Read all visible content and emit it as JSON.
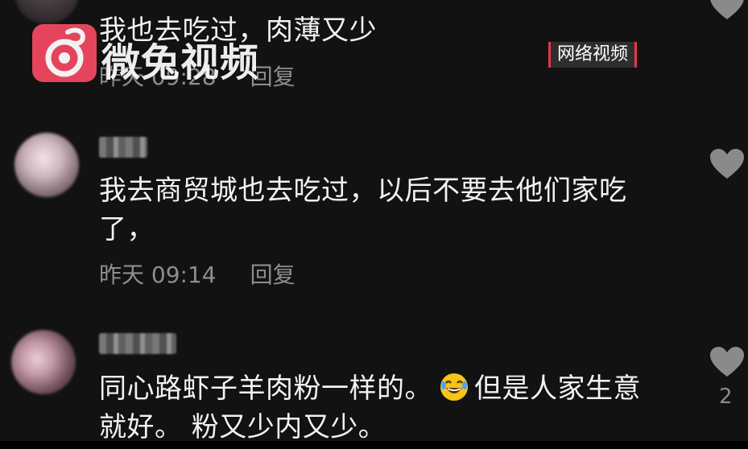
{
  "watermark": {
    "logo_text": "微兔视频",
    "tag": "网络视频"
  },
  "comments": [
    {
      "text_lines": [
        "我也去吃过，肉薄又少"
      ],
      "time": "昨天 09:28",
      "reply_label": "回复",
      "likes": ""
    },
    {
      "text_lines": [
        "我去商贸城也去吃过，以后不要去他们家吃",
        "了，"
      ],
      "time": "昨天 09:14",
      "reply_label": "回复",
      "likes": ""
    },
    {
      "text_line1_a": "同心路虾子羊肉粉一样的。",
      "emoji": "grinning-tears-emoji",
      "text_line1_b": "但是人家生意",
      "text_line2": "就好。 粉又少内又少。",
      "likes": "2"
    }
  ],
  "colors": {
    "background": "#121212",
    "text": "#f2f2f2",
    "meta": "#8e8e8e",
    "heart": "#8a8a8a",
    "logo": "#f04860",
    "tag_border": "#e8354c"
  }
}
